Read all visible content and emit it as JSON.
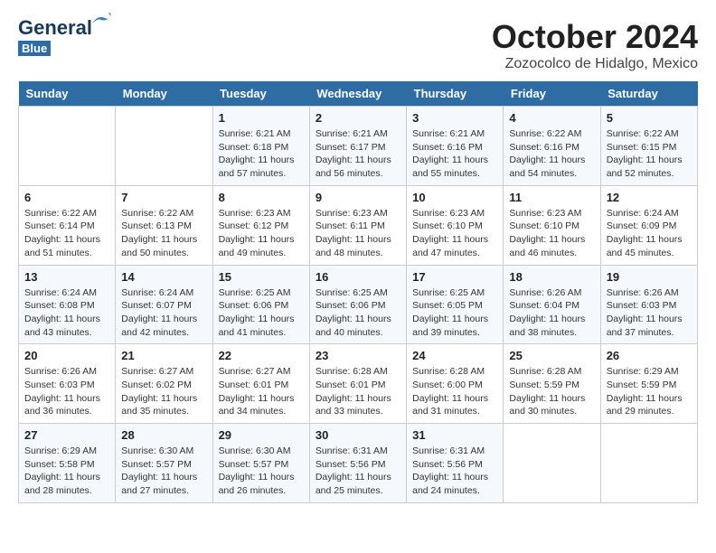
{
  "header": {
    "logo_line1": "General",
    "logo_line2": "Blue",
    "month": "October 2024",
    "location": "Zozocolco de Hidalgo, Mexico"
  },
  "days_of_week": [
    "Sunday",
    "Monday",
    "Tuesday",
    "Wednesday",
    "Thursday",
    "Friday",
    "Saturday"
  ],
  "weeks": [
    [
      {
        "day": "",
        "sunrise": "",
        "sunset": "",
        "daylight": ""
      },
      {
        "day": "",
        "sunrise": "",
        "sunset": "",
        "daylight": ""
      },
      {
        "day": "1",
        "sunrise": "Sunrise: 6:21 AM",
        "sunset": "Sunset: 6:18 PM",
        "daylight": "Daylight: 11 hours and 57 minutes."
      },
      {
        "day": "2",
        "sunrise": "Sunrise: 6:21 AM",
        "sunset": "Sunset: 6:17 PM",
        "daylight": "Daylight: 11 hours and 56 minutes."
      },
      {
        "day": "3",
        "sunrise": "Sunrise: 6:21 AM",
        "sunset": "Sunset: 6:16 PM",
        "daylight": "Daylight: 11 hours and 55 minutes."
      },
      {
        "day": "4",
        "sunrise": "Sunrise: 6:22 AM",
        "sunset": "Sunset: 6:16 PM",
        "daylight": "Daylight: 11 hours and 54 minutes."
      },
      {
        "day": "5",
        "sunrise": "Sunrise: 6:22 AM",
        "sunset": "Sunset: 6:15 PM",
        "daylight": "Daylight: 11 hours and 52 minutes."
      }
    ],
    [
      {
        "day": "6",
        "sunrise": "Sunrise: 6:22 AM",
        "sunset": "Sunset: 6:14 PM",
        "daylight": "Daylight: 11 hours and 51 minutes."
      },
      {
        "day": "7",
        "sunrise": "Sunrise: 6:22 AM",
        "sunset": "Sunset: 6:13 PM",
        "daylight": "Daylight: 11 hours and 50 minutes."
      },
      {
        "day": "8",
        "sunrise": "Sunrise: 6:23 AM",
        "sunset": "Sunset: 6:12 PM",
        "daylight": "Daylight: 11 hours and 49 minutes."
      },
      {
        "day": "9",
        "sunrise": "Sunrise: 6:23 AM",
        "sunset": "Sunset: 6:11 PM",
        "daylight": "Daylight: 11 hours and 48 minutes."
      },
      {
        "day": "10",
        "sunrise": "Sunrise: 6:23 AM",
        "sunset": "Sunset: 6:10 PM",
        "daylight": "Daylight: 11 hours and 47 minutes."
      },
      {
        "day": "11",
        "sunrise": "Sunrise: 6:23 AM",
        "sunset": "Sunset: 6:10 PM",
        "daylight": "Daylight: 11 hours and 46 minutes."
      },
      {
        "day": "12",
        "sunrise": "Sunrise: 6:24 AM",
        "sunset": "Sunset: 6:09 PM",
        "daylight": "Daylight: 11 hours and 45 minutes."
      }
    ],
    [
      {
        "day": "13",
        "sunrise": "Sunrise: 6:24 AM",
        "sunset": "Sunset: 6:08 PM",
        "daylight": "Daylight: 11 hours and 43 minutes."
      },
      {
        "day": "14",
        "sunrise": "Sunrise: 6:24 AM",
        "sunset": "Sunset: 6:07 PM",
        "daylight": "Daylight: 11 hours and 42 minutes."
      },
      {
        "day": "15",
        "sunrise": "Sunrise: 6:25 AM",
        "sunset": "Sunset: 6:06 PM",
        "daylight": "Daylight: 11 hours and 41 minutes."
      },
      {
        "day": "16",
        "sunrise": "Sunrise: 6:25 AM",
        "sunset": "Sunset: 6:06 PM",
        "daylight": "Daylight: 11 hours and 40 minutes."
      },
      {
        "day": "17",
        "sunrise": "Sunrise: 6:25 AM",
        "sunset": "Sunset: 6:05 PM",
        "daylight": "Daylight: 11 hours and 39 minutes."
      },
      {
        "day": "18",
        "sunrise": "Sunrise: 6:26 AM",
        "sunset": "Sunset: 6:04 PM",
        "daylight": "Daylight: 11 hours and 38 minutes."
      },
      {
        "day": "19",
        "sunrise": "Sunrise: 6:26 AM",
        "sunset": "Sunset: 6:03 PM",
        "daylight": "Daylight: 11 hours and 37 minutes."
      }
    ],
    [
      {
        "day": "20",
        "sunrise": "Sunrise: 6:26 AM",
        "sunset": "Sunset: 6:03 PM",
        "daylight": "Daylight: 11 hours and 36 minutes."
      },
      {
        "day": "21",
        "sunrise": "Sunrise: 6:27 AM",
        "sunset": "Sunset: 6:02 PM",
        "daylight": "Daylight: 11 hours and 35 minutes."
      },
      {
        "day": "22",
        "sunrise": "Sunrise: 6:27 AM",
        "sunset": "Sunset: 6:01 PM",
        "daylight": "Daylight: 11 hours and 34 minutes."
      },
      {
        "day": "23",
        "sunrise": "Sunrise: 6:28 AM",
        "sunset": "Sunset: 6:01 PM",
        "daylight": "Daylight: 11 hours and 33 minutes."
      },
      {
        "day": "24",
        "sunrise": "Sunrise: 6:28 AM",
        "sunset": "Sunset: 6:00 PM",
        "daylight": "Daylight: 11 hours and 31 minutes."
      },
      {
        "day": "25",
        "sunrise": "Sunrise: 6:28 AM",
        "sunset": "Sunset: 5:59 PM",
        "daylight": "Daylight: 11 hours and 30 minutes."
      },
      {
        "day": "26",
        "sunrise": "Sunrise: 6:29 AM",
        "sunset": "Sunset: 5:59 PM",
        "daylight": "Daylight: 11 hours and 29 minutes."
      }
    ],
    [
      {
        "day": "27",
        "sunrise": "Sunrise: 6:29 AM",
        "sunset": "Sunset: 5:58 PM",
        "daylight": "Daylight: 11 hours and 28 minutes."
      },
      {
        "day": "28",
        "sunrise": "Sunrise: 6:30 AM",
        "sunset": "Sunset: 5:57 PM",
        "daylight": "Daylight: 11 hours and 27 minutes."
      },
      {
        "day": "29",
        "sunrise": "Sunrise: 6:30 AM",
        "sunset": "Sunset: 5:57 PM",
        "daylight": "Daylight: 11 hours and 26 minutes."
      },
      {
        "day": "30",
        "sunrise": "Sunrise: 6:31 AM",
        "sunset": "Sunset: 5:56 PM",
        "daylight": "Daylight: 11 hours and 25 minutes."
      },
      {
        "day": "31",
        "sunrise": "Sunrise: 6:31 AM",
        "sunset": "Sunset: 5:56 PM",
        "daylight": "Daylight: 11 hours and 24 minutes."
      },
      {
        "day": "",
        "sunrise": "",
        "sunset": "",
        "daylight": ""
      },
      {
        "day": "",
        "sunrise": "",
        "sunset": "",
        "daylight": ""
      }
    ]
  ]
}
